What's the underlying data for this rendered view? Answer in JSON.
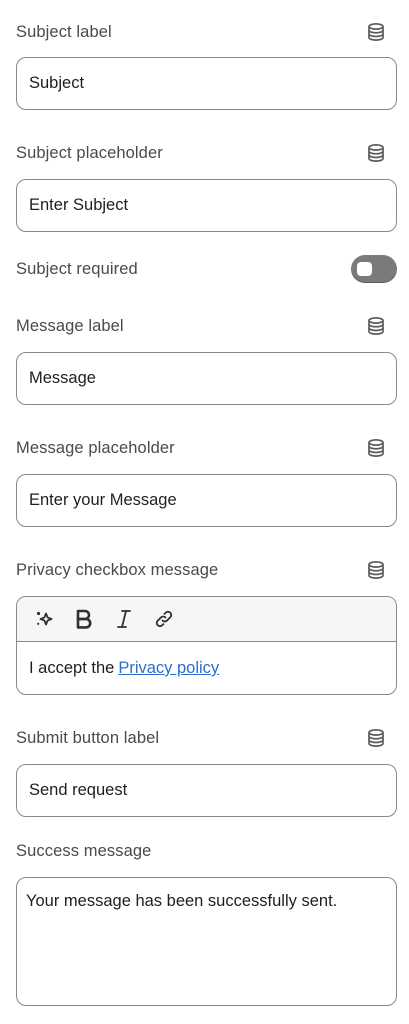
{
  "subject_label": {
    "label": "Subject label",
    "value": "Subject"
  },
  "subject_placeholder": {
    "label": "Subject placeholder",
    "value": "Enter Subject"
  },
  "subject_required": {
    "label": "Subject required",
    "enabled": false
  },
  "message_label": {
    "label": "Message label",
    "value": "Message"
  },
  "message_placeholder": {
    "label": "Message placeholder",
    "value": "Enter your Message"
  },
  "privacy_checkbox": {
    "label": "Privacy checkbox message",
    "toolbar": [
      "magic-icon",
      "bold-icon",
      "italic-icon",
      "link-icon"
    ],
    "text_prefix": "I accept the",
    "link_text": "Privacy policy"
  },
  "submit_button_label": {
    "label": "Submit button label",
    "value": "Send request"
  },
  "success_message": {
    "label": "Success message",
    "value": "Your message has been successfully sent."
  },
  "colors": {
    "link": "#2c6ecb",
    "toggle_off": "#7a7a7a",
    "border": "#8a8a8a"
  }
}
